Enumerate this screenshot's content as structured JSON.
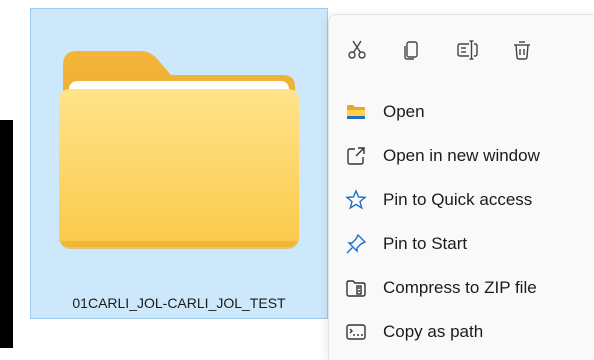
{
  "folder": {
    "name": "01CARLI_JOL-CARLI_JOL_TEST"
  },
  "context_menu": {
    "quick_actions": [
      {
        "icon": "cut-icon",
        "action": "Cut"
      },
      {
        "icon": "copy-icon",
        "action": "Copy"
      },
      {
        "icon": "rename-icon",
        "action": "Rename"
      },
      {
        "icon": "delete-icon",
        "action": "Delete"
      }
    ],
    "items": [
      {
        "label": "Open",
        "icon": "folder-open-icon"
      },
      {
        "label": "Open in new window",
        "icon": "open-new-window-icon"
      },
      {
        "label": "Pin to Quick access",
        "icon": "star-icon"
      },
      {
        "label": "Pin to Start",
        "icon": "pin-icon"
      },
      {
        "label": "Compress to ZIP file",
        "icon": "zip-archive-icon"
      },
      {
        "label": "Copy as path",
        "icon": "copy-path-icon"
      }
    ]
  },
  "colors": {
    "selection_background": "#cde8fb",
    "selection_border": "#9ccbee",
    "icon_blue": "#1f6fc4",
    "menu_background": "#f9f9f9"
  }
}
